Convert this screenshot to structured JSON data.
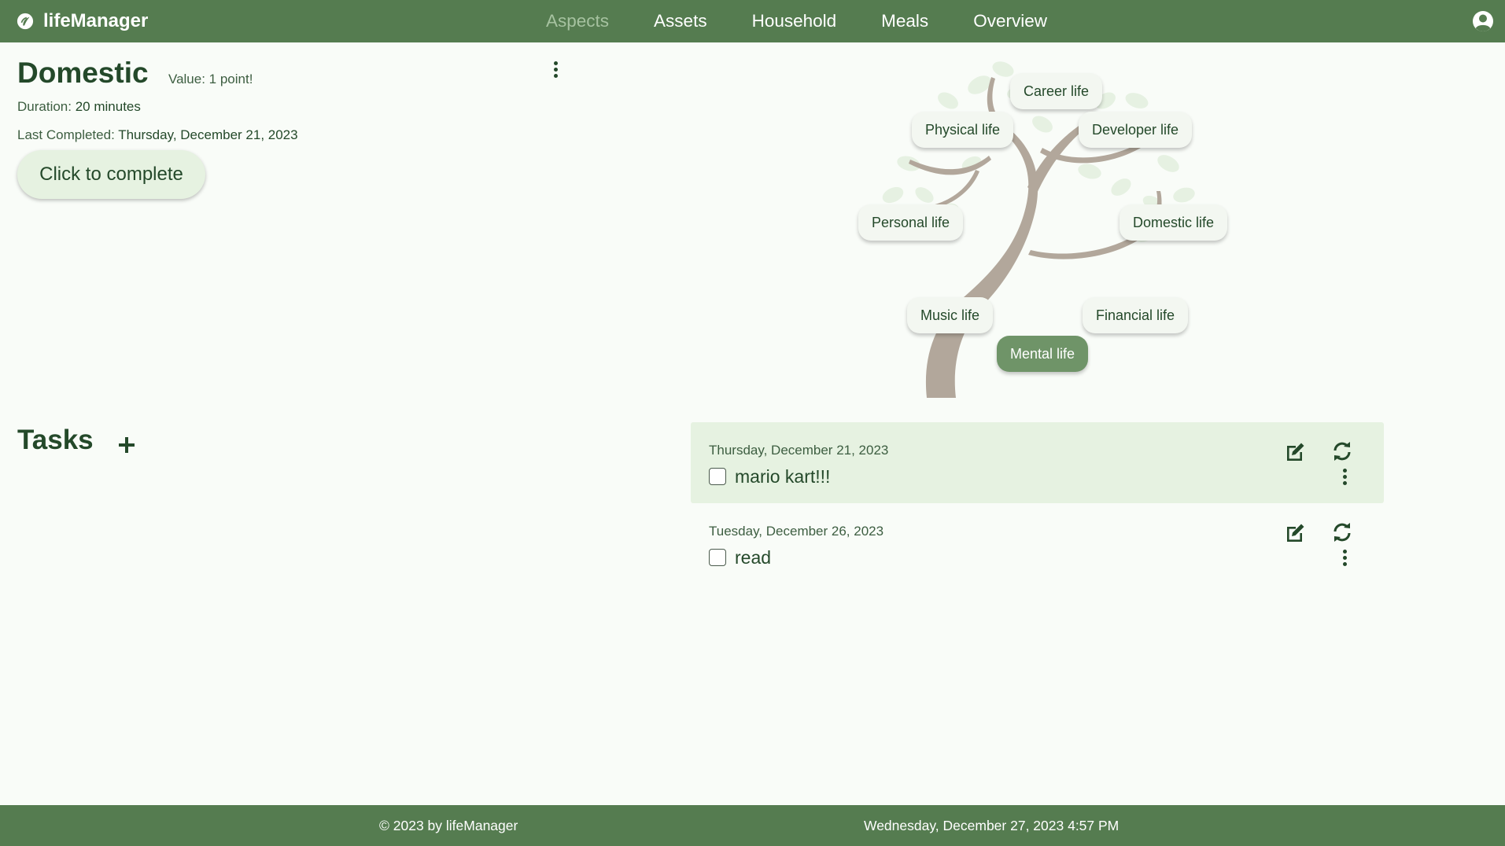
{
  "app": {
    "brand": "lifeManager",
    "nav": [
      "Aspects",
      "Assets",
      "Household",
      "Meals",
      "Overview"
    ],
    "active_nav": "Aspects"
  },
  "aspect": {
    "title": "Domestic",
    "value_label": "Value: 1 point!",
    "duration_label": "Duration:",
    "duration_value": "20 minutes",
    "last_completed_label": "Last Completed:",
    "last_completed_value": "Thursday, December 21, 2023",
    "complete_button": "Click to complete"
  },
  "tree": {
    "aspects": [
      {
        "label": "Career life",
        "selected": false
      },
      {
        "label": "Physical life",
        "selected": false
      },
      {
        "label": "Developer life",
        "selected": false
      },
      {
        "label": "Personal life",
        "selected": false
      },
      {
        "label": "Domestic life",
        "selected": false
      },
      {
        "label": "Music life",
        "selected": false
      },
      {
        "label": "Financial life",
        "selected": false
      },
      {
        "label": "Mental life",
        "selected": true
      }
    ]
  },
  "tasks": {
    "heading": "Tasks",
    "items": [
      {
        "date": "Thursday, December 21, 2023",
        "label": "mario kart!!!",
        "checked": false,
        "highlighted": true
      },
      {
        "date": "Tuesday, December 26, 2023",
        "label": "read",
        "checked": false,
        "highlighted": false
      }
    ]
  },
  "footer": {
    "copyright": "© 2023 by lifeManager",
    "datetime": "Wednesday, December 27, 2023 4:57 PM"
  },
  "colors": {
    "primary": "#557c50",
    "dark_text": "#24492a",
    "highlight": "#e6f2e1",
    "selected_chip": "#6f9468",
    "tree_trunk": "#b2a79b",
    "leaf": "#deeedb"
  },
  "icons": [
    "lifemanager-logo-icon",
    "user-account-icon",
    "kebab-menu-icon",
    "plus-icon",
    "edit-icon",
    "refresh-icon",
    "checkbox"
  ]
}
